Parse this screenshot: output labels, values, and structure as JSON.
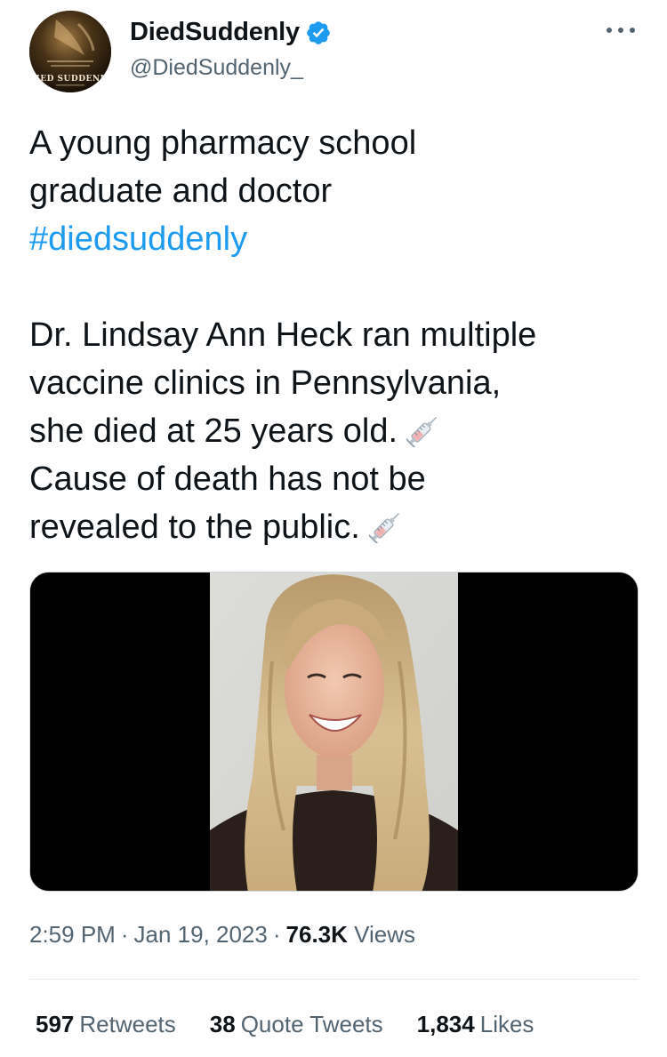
{
  "author": {
    "display_name": "DiedSuddenly",
    "handle": "@DiedSuddenly_",
    "verified_icon": "verified-badge-icon",
    "avatar_text": "DIED SUDDENLY"
  },
  "more_icon": "ellipsis-icon",
  "tweet": {
    "line1": "A young pharmacy school",
    "line2": "graduate and doctor",
    "hashtag": "#diedsuddenly",
    "line3": "Dr. Lindsay Ann Heck ran multiple",
    "line4": "vaccine clinics in Pennsylvania,",
    "line5": "she died at 25 years old.",
    "line6": "Cause of death has not be",
    "line7": "revealed to the public.",
    "emoji_icon": "syringe-icon"
  },
  "meta": {
    "time": "2:59 PM",
    "separator": "·",
    "date": "Jan 19, 2023",
    "views_count": "76.3K",
    "views_label": "Views"
  },
  "stats": {
    "retweets_count": "597",
    "retweets_label": "Retweets",
    "quotes_count": "38",
    "quotes_label": "Quote Tweets",
    "likes_count": "1,834",
    "likes_label": "Likes"
  },
  "colors": {
    "link": "#1d9bf0",
    "secondary_text": "#536471",
    "primary_text": "#0f1419",
    "verified": "#1d9bf0"
  }
}
